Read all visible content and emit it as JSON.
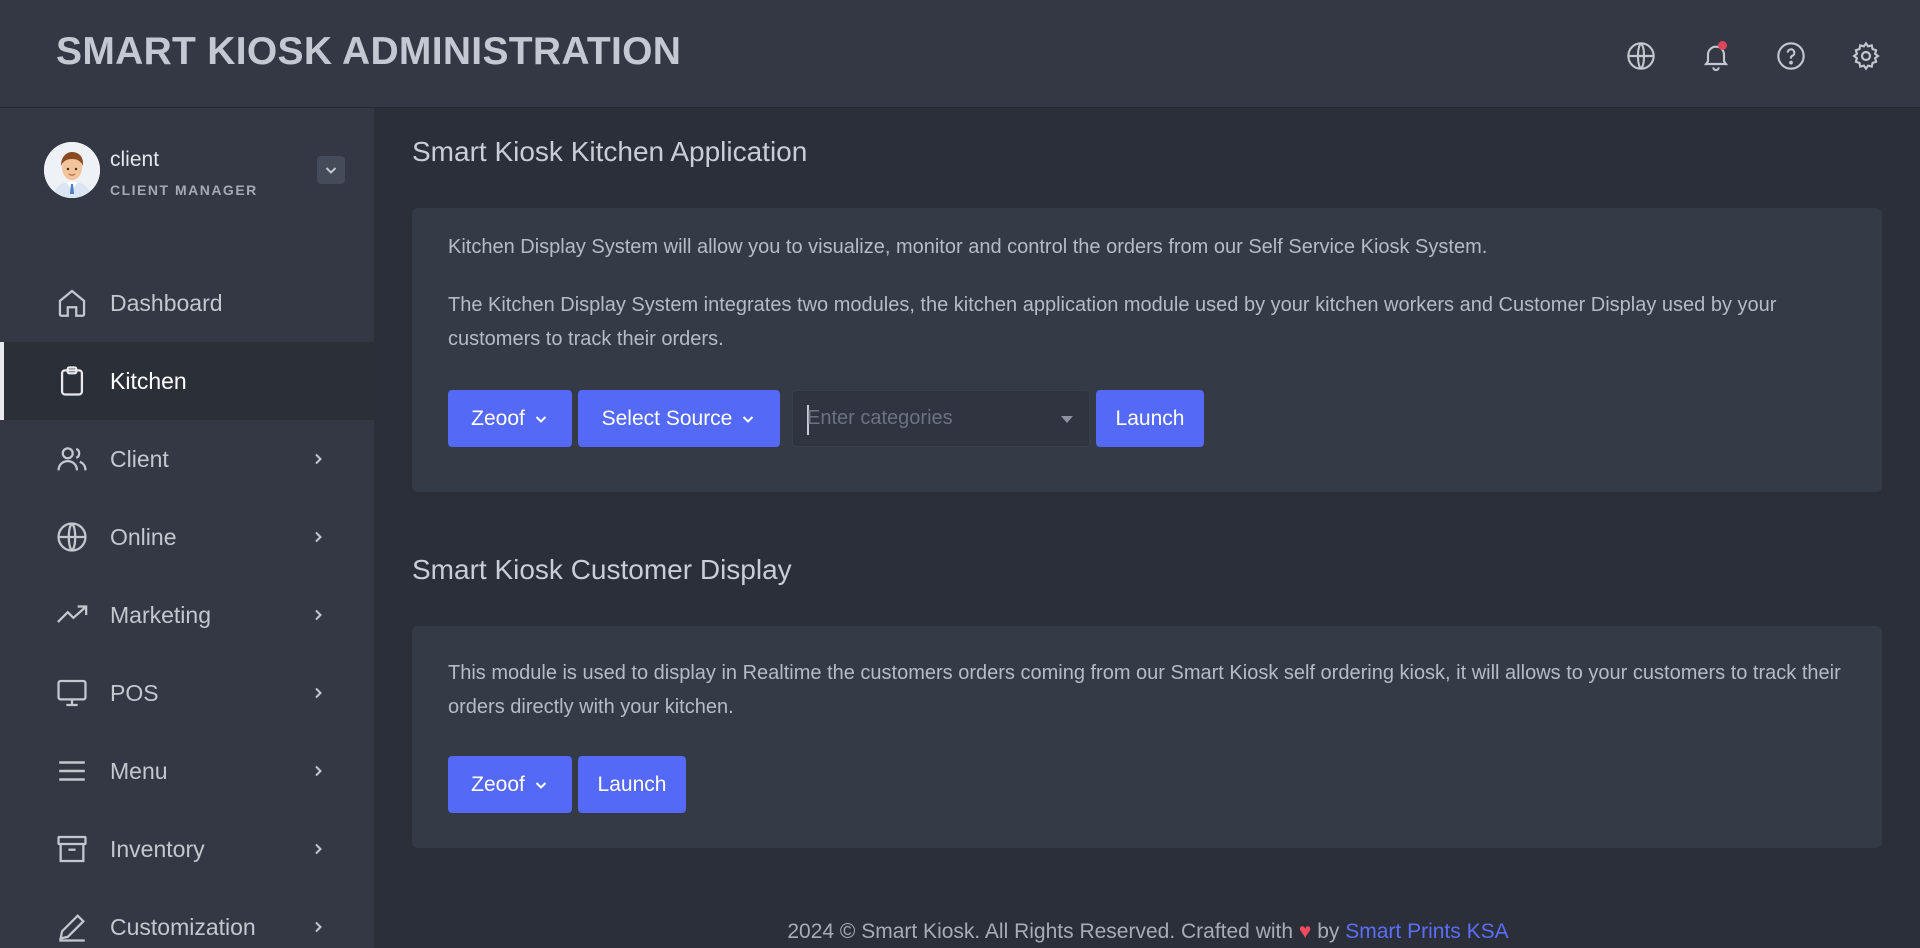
{
  "header": {
    "title": "SMART KIOSK ADMINISTRATION",
    "icons": [
      "globe-icon",
      "bell-icon",
      "help-icon",
      "gear-icon"
    ]
  },
  "user": {
    "name": "client",
    "role": "CLIENT MANAGER"
  },
  "sidebar": {
    "items": [
      {
        "label": "Dashboard",
        "icon": "home-icon",
        "active": false,
        "has_chevron": false
      },
      {
        "label": "Kitchen",
        "icon": "clipboard-icon",
        "active": true,
        "has_chevron": false
      },
      {
        "label": "Client",
        "icon": "users-icon",
        "active": false,
        "has_chevron": true
      },
      {
        "label": "Online",
        "icon": "globe-icon",
        "active": false,
        "has_chevron": true
      },
      {
        "label": "Marketing",
        "icon": "trending-up-icon",
        "active": false,
        "has_chevron": true
      },
      {
        "label": "POS",
        "icon": "monitor-icon",
        "active": false,
        "has_chevron": true
      },
      {
        "label": "Menu",
        "icon": "menu-lines-icon",
        "active": false,
        "has_chevron": true
      },
      {
        "label": "Inventory",
        "icon": "archive-box-icon",
        "active": false,
        "has_chevron": true
      },
      {
        "label": "Customization",
        "icon": "pen-icon",
        "active": false,
        "has_chevron": true
      }
    ]
  },
  "kitchen": {
    "title": "Smart Kiosk Kitchen Application",
    "paragraph1": "Kitchen Display System will allow you to visualize, monitor and control the orders from our Self Service Kiosk System.",
    "paragraph2": "The Kitchen Display System integrates two modules, the kitchen application module used by your kitchen workers and Customer Display used by your customers to track their orders.",
    "store_label": "Zeoof",
    "source_label": "Select Source",
    "categories_placeholder": "Enter categories",
    "launch_label": "Launch"
  },
  "customer_display": {
    "title": "Smart Kiosk Customer Display",
    "paragraph": "This module is used to display in Realtime the customers orders coming from our Smart Kiosk self ordering kiosk, it will allows to your customers to track their orders directly with your kitchen.",
    "store_label": "Zeoof",
    "launch_label": "Launch"
  },
  "footer": {
    "text_before": "2024 © Smart Kiosk. All Rights Reserved. Crafted with",
    "heart": "♥",
    "by": "by",
    "link": "Smart Prints KSA"
  },
  "colors": {
    "accent": "#5469f5",
    "background": "#2a2f3a",
    "panel": "#333844",
    "notification": "#e0455a"
  }
}
